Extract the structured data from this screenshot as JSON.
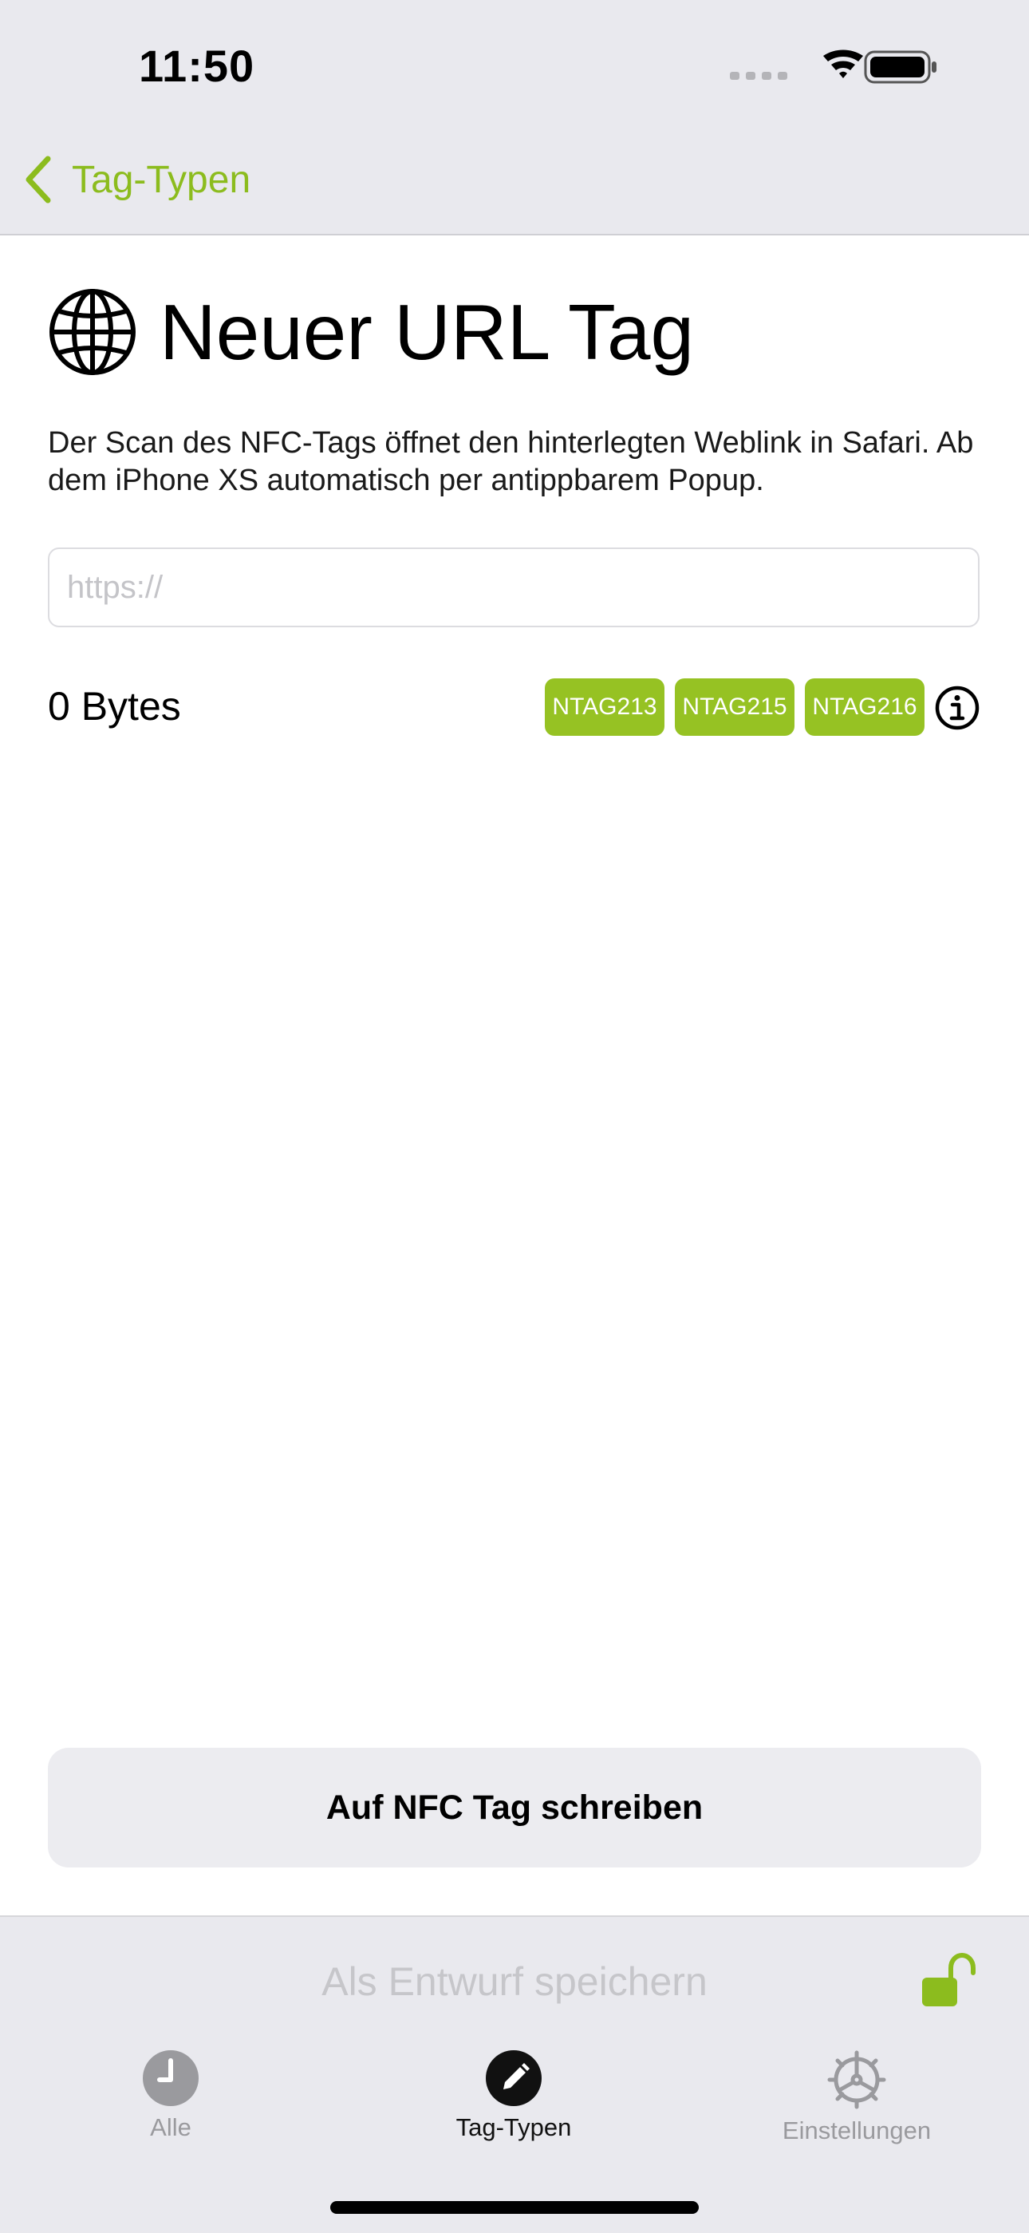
{
  "status_bar": {
    "time": "11:50"
  },
  "nav": {
    "back_label": "Tag-Typen"
  },
  "header": {
    "icon": "globe-icon",
    "title": "Neuer URL Tag"
  },
  "description": "Der Scan des NFC-Tags öffnet den hinterlegten Weblink in Safari. Ab dem iPhone XS automatisch per antippbarem Popup.",
  "url_field": {
    "value": "",
    "placeholder": "https://"
  },
  "size": {
    "label": "0 Bytes"
  },
  "tag_types": [
    "NTAG213",
    "NTAG215",
    "NTAG216"
  ],
  "write_button": "Auf NFC Tag schreiben",
  "draft_button": "Als Entwurf speichern",
  "tabs": [
    {
      "label": "Alle",
      "icon": "clock-icon",
      "active": false
    },
    {
      "label": "Tag-Typen",
      "icon": "pencil-icon",
      "active": true
    },
    {
      "label": "Einstellungen",
      "icon": "gear-icon",
      "active": false
    }
  ],
  "colors": {
    "accent": "#8cbc1e",
    "chip": "#96c223",
    "tab_active": "#111111",
    "tab_inactive": "#9a9a9e",
    "bar_background": "#e9e9ee"
  }
}
